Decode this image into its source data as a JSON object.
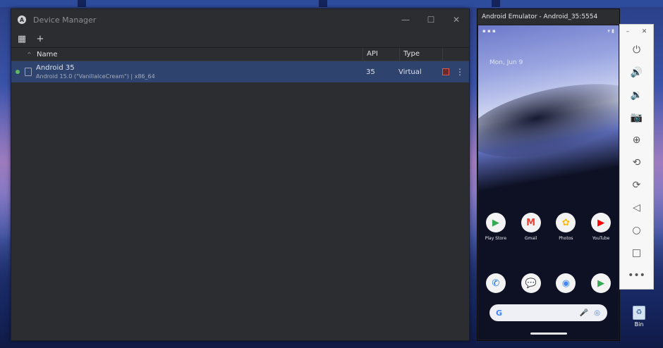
{
  "device_manager": {
    "title": "Device Manager",
    "logo_letter": "A",
    "window_controls": {
      "minimize": "—",
      "maximize": "☐",
      "close": "✕"
    },
    "toolbar": {
      "grid_icon": "▦",
      "add_icon": "+"
    },
    "columns": {
      "name": "Name",
      "api": "API",
      "type": "Type"
    },
    "devices": [
      {
        "name": "Android 35",
        "details": "Android 15.0 (\"VanillaIceCream\") | x86_64",
        "api": "35",
        "type": "Virtual"
      }
    ]
  },
  "emulator": {
    "title": "Android Emulator - Android_35:5554",
    "date": "Mon, Jun 9",
    "apps_row1": [
      {
        "label": "Play Store",
        "glyph": "▶",
        "color": "#34a853"
      },
      {
        "label": "Gmail",
        "glyph": "M",
        "color": "#ea4335"
      },
      {
        "label": "Photos",
        "glyph": "✿",
        "color": "#fbbc05"
      },
      {
        "label": "YouTube",
        "glyph": "▶",
        "color": "#ff0000"
      }
    ],
    "apps_row2": [
      {
        "glyph": "✆",
        "color": "#1a73e8"
      },
      {
        "glyph": "💬",
        "color": "#1a73e8"
      },
      {
        "glyph": "◉",
        "color": "#4285f4"
      },
      {
        "glyph": "▶",
        "color": "#34a853"
      }
    ],
    "search": {
      "g": "G",
      "mic": "🎤",
      "lens": "◎"
    }
  },
  "side_toolbar": {
    "minimize": "–",
    "close": "✕",
    "buttons": [
      {
        "name": "power-icon",
        "glyph": "⏻"
      },
      {
        "name": "volume-up-icon",
        "glyph": "🔊"
      },
      {
        "name": "volume-down-icon",
        "glyph": "🔉"
      },
      {
        "name": "camera-icon",
        "glyph": "📷"
      },
      {
        "name": "zoom-icon",
        "glyph": "⊕"
      },
      {
        "name": "rotate-left-icon",
        "glyph": "⟲"
      },
      {
        "name": "rotate-right-icon",
        "glyph": "⟳"
      },
      {
        "name": "back-icon",
        "glyph": "◁"
      },
      {
        "name": "home-icon",
        "glyph": "○"
      },
      {
        "name": "overview-icon",
        "glyph": "□"
      },
      {
        "name": "more-icon",
        "glyph": "•••"
      }
    ]
  },
  "desktop": {
    "recycle_bin_label": "Bin"
  }
}
